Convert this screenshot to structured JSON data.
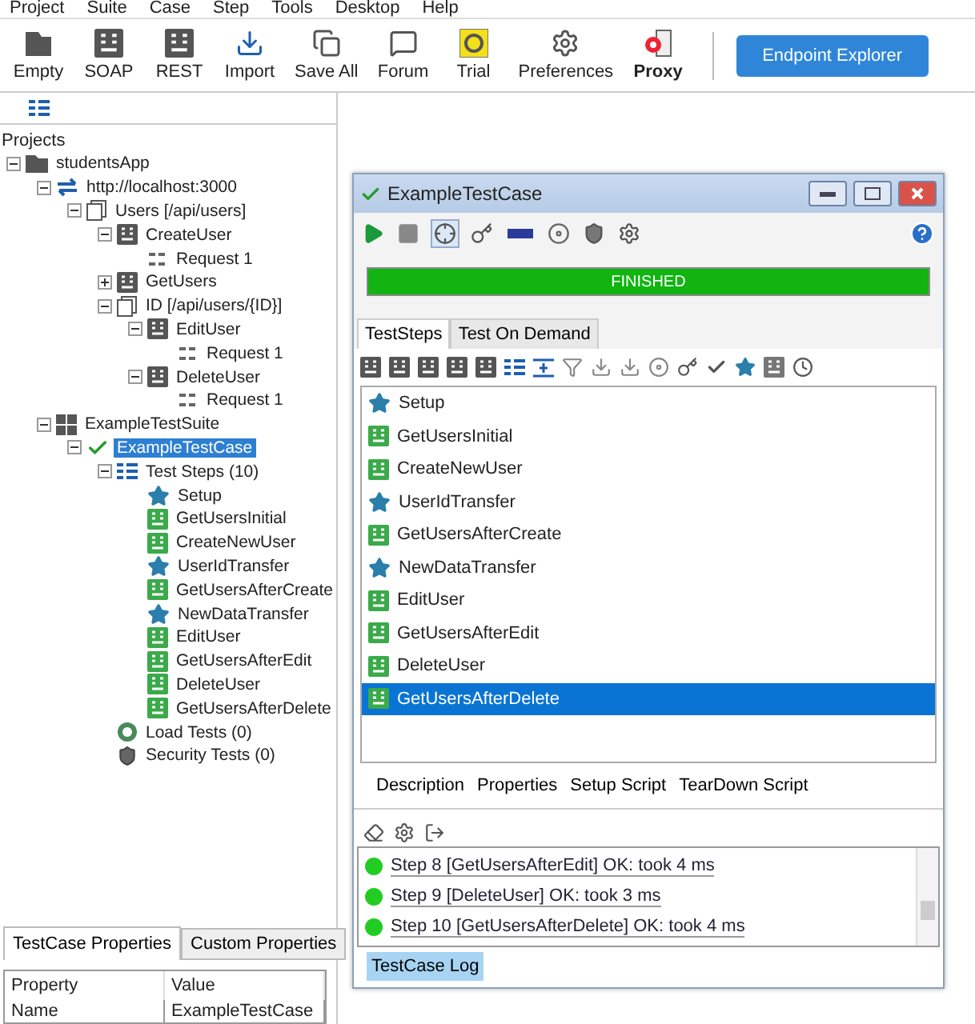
{
  "menu": [
    "Project",
    "Suite",
    "Case",
    "Step",
    "Tools",
    "Desktop",
    "Help"
  ],
  "toolbar": [
    {
      "label": "Empty",
      "kind": "empty"
    },
    {
      "label": "SOAP",
      "kind": "soap"
    },
    {
      "label": "REST",
      "kind": "rest"
    },
    {
      "label": "Import",
      "kind": "import"
    },
    {
      "label": "Save All",
      "kind": "saveall"
    },
    {
      "label": "Forum",
      "kind": "forum"
    },
    {
      "label": "Trial",
      "kind": "trial"
    },
    {
      "label": "Preferences",
      "kind": "preferences"
    },
    {
      "label": "Proxy",
      "kind": "proxy"
    }
  ],
  "endpoint_button": "Endpoint Explorer",
  "navigator": {
    "title": "Projects",
    "tree": [
      {
        "label": "studentsApp",
        "kind": "project",
        "expanded": true,
        "selected": false,
        "children": [
          {
            "label": "http://localhost:3000",
            "kind": "service",
            "expanded": true,
            "selected": false,
            "children": [
              {
                "label": "Users [/api/users]",
                "kind": "resource",
                "expanded": true,
                "selected": false,
                "children": [
                  {
                    "label": "CreateUser",
                    "kind": "method",
                    "expanded": true,
                    "selected": false,
                    "children": [
                      {
                        "label": "Request 1",
                        "kind": "request",
                        "selected": false
                      }
                    ]
                  },
                  {
                    "label": "GetUsers",
                    "kind": "method",
                    "expanded": false,
                    "selected": false
                  },
                  {
                    "label": "ID [/api/users/{ID}]",
                    "kind": "resource",
                    "expanded": true,
                    "selected": false,
                    "children": [
                      {
                        "label": "EditUser",
                        "kind": "method",
                        "expanded": true,
                        "selected": false,
                        "children": [
                          {
                            "label": "Request 1",
                            "kind": "request",
                            "selected": false
                          }
                        ]
                      },
                      {
                        "label": "DeleteUser",
                        "kind": "method",
                        "expanded": true,
                        "selected": false,
                        "children": [
                          {
                            "label": "Request 1",
                            "kind": "request",
                            "selected": false
                          }
                        ]
                      }
                    ]
                  }
                ]
              }
            ]
          },
          {
            "label": "ExampleTestSuite",
            "kind": "suite",
            "expanded": true,
            "selected": false,
            "children": [
              {
                "label": "ExampleTestCase",
                "kind": "testcase",
                "expanded": true,
                "selected": true,
                "children": [
                  {
                    "label": "Test Steps (10)",
                    "kind": "steps",
                    "expanded": true,
                    "selected": false,
                    "children": [
                      {
                        "label": "Setup",
                        "kind": "transfer",
                        "selected": false
                      },
                      {
                        "label": "GetUsersInitial",
                        "kind": "rest",
                        "selected": false
                      },
                      {
                        "label": "CreateNewUser",
                        "kind": "rest",
                        "selected": false
                      },
                      {
                        "label": "UserIdTransfer",
                        "kind": "transfer",
                        "selected": false
                      },
                      {
                        "label": "GetUsersAfterCreate",
                        "kind": "rest",
                        "selected": false
                      },
                      {
                        "label": "NewDataTransfer",
                        "kind": "transfer",
                        "selected": false
                      },
                      {
                        "label": "EditUser",
                        "kind": "rest",
                        "selected": false
                      },
                      {
                        "label": "GetUsersAfterEdit",
                        "kind": "rest",
                        "selected": false
                      },
                      {
                        "label": "DeleteUser",
                        "kind": "rest",
                        "selected": false
                      },
                      {
                        "label": "GetUsersAfterDelete",
                        "kind": "rest",
                        "selected": false
                      }
                    ]
                  },
                  {
                    "label": "Load Tests (0)",
                    "kind": "load",
                    "selected": false
                  },
                  {
                    "label": "Security Tests (0)",
                    "kind": "security",
                    "selected": false
                  }
                ]
              }
            ]
          }
        ]
      }
    ]
  },
  "properties": {
    "tabs": [
      {
        "label": "TestCase Properties",
        "selected": true
      },
      {
        "label": "Custom Properties",
        "selected": false
      }
    ],
    "columns": [
      "Property",
      "Value"
    ],
    "rows": [
      [
        "Name",
        "ExampleTestCase"
      ]
    ]
  },
  "testcase_window": {
    "title": "ExampleTestCase",
    "progress": {
      "label": "FINISHED",
      "level": 1
    },
    "tabs": [
      {
        "label": "TestSteps",
        "selected": true
      },
      {
        "label": "Test On Demand",
        "selected": false
      }
    ],
    "steps": [
      {
        "label": "Setup",
        "kind": "transfer",
        "selected": false
      },
      {
        "label": "GetUsersInitial",
        "kind": "rest",
        "selected": false
      },
      {
        "label": "CreateNewUser",
        "kind": "rest",
        "selected": false
      },
      {
        "label": "UserIdTransfer",
        "kind": "transfer",
        "selected": false
      },
      {
        "label": "GetUsersAfterCreate",
        "kind": "rest",
        "selected": false
      },
      {
        "label": "NewDataTransfer",
        "kind": "transfer",
        "selected": false
      },
      {
        "label": "EditUser",
        "kind": "rest",
        "selected": false
      },
      {
        "label": "GetUsersAfterEdit",
        "kind": "rest",
        "selected": false
      },
      {
        "label": "DeleteUser",
        "kind": "rest",
        "selected": false
      },
      {
        "label": "GetUsersAfterDelete",
        "kind": "rest",
        "selected": true
      }
    ],
    "bottom_tabs": [
      "Description",
      "Properties",
      "Setup Script",
      "TearDown Script"
    ],
    "log": [
      {
        "text": "Step 8 [GetUsersAfterEdit] OK: took 4 ms"
      },
      {
        "text": "Step 9 [DeleteUser] OK: took 3 ms"
      },
      {
        "text": "Step 10 [GetUsersAfterDelete] OK: took 4 ms"
      }
    ],
    "log_tabs": [
      {
        "label": "TestCase Log",
        "selected": true
      }
    ]
  }
}
